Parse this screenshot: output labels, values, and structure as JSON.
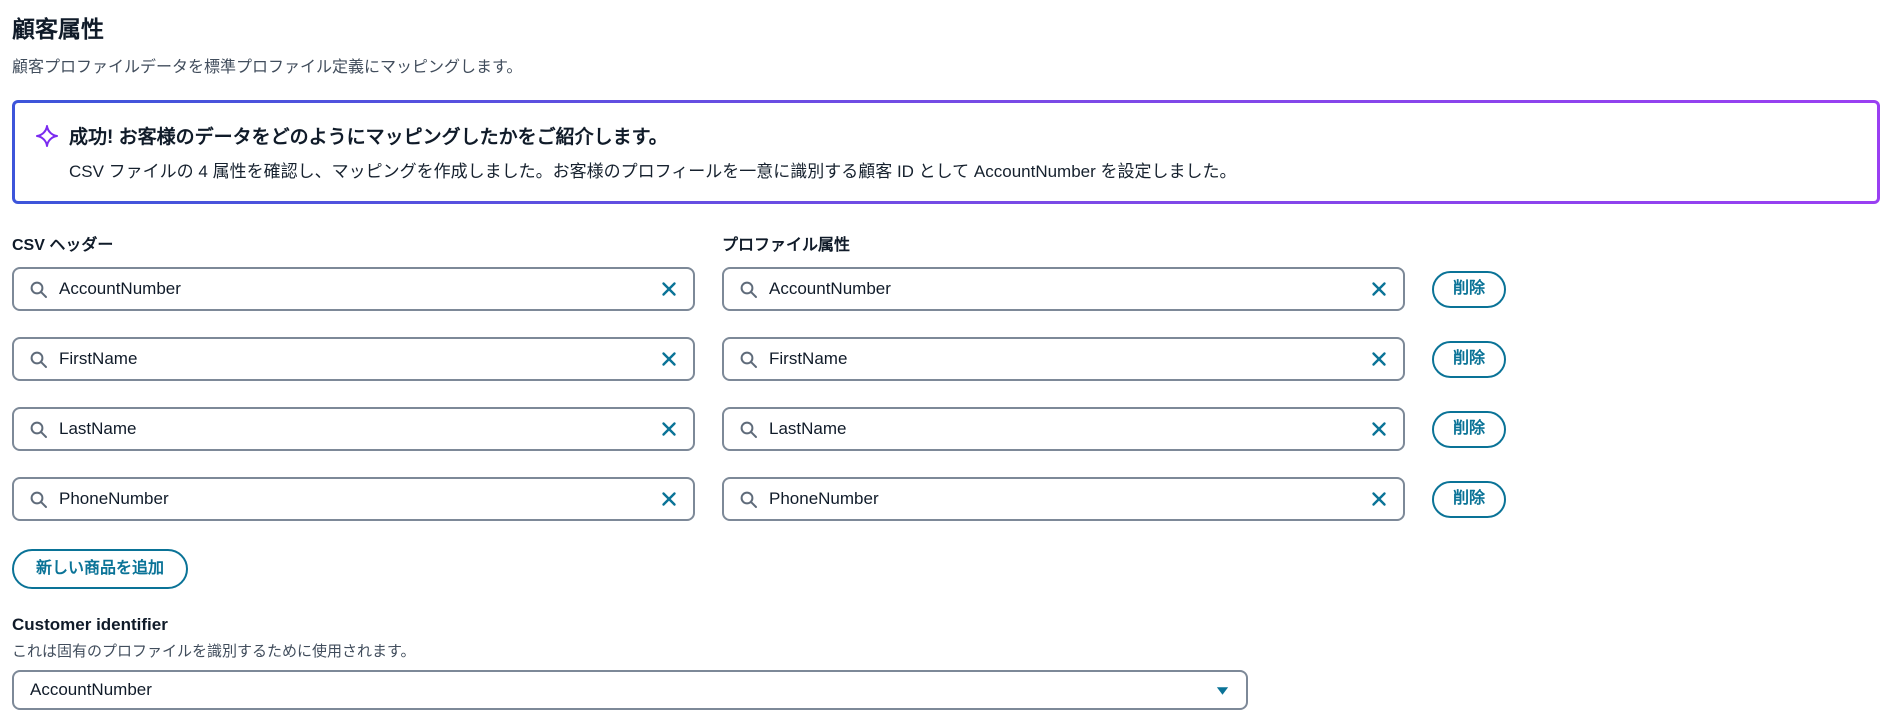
{
  "page": {
    "title": "顧客属性",
    "subtitle": "顧客プロファイルデータを標準プロファイル定義にマッピングします。"
  },
  "banner": {
    "icon": "sparkle-icon",
    "title": "成功! お客様のデータをどのようにマッピングしたかをご紹介します。",
    "description": "CSV ファイルの 4 属性を確認し、マッピングを作成しました。お客様のプロフィールを一意に識別する顧客 ID として AccountNumber を設定しました。"
  },
  "mapping": {
    "csv_header_label": "CSV ヘッダー",
    "profile_attribute_label": "プロファイル属性",
    "delete_label": "削除",
    "add_button_label": "新しい商品を追加",
    "rows": [
      {
        "csv_header": "AccountNumber",
        "profile_attribute": "AccountNumber"
      },
      {
        "csv_header": "FirstName",
        "profile_attribute": "FirstName"
      },
      {
        "csv_header": "LastName",
        "profile_attribute": "LastName"
      },
      {
        "csv_header": "PhoneNumber",
        "profile_attribute": "PhoneNumber"
      }
    ]
  },
  "customer_identifier": {
    "label": "Customer identifier",
    "description": "これは固有のプロファイルを識別するために使用されます。",
    "selected_value": "AccountNumber"
  },
  "icons": {
    "search": "search-icon",
    "clear": "clear-x-icon",
    "caret": "caret-down-icon"
  },
  "colors": {
    "accent_teal": "#0a7397",
    "banner_gradient_start": "#3d55da",
    "banner_gradient_end": "#9a3ff2",
    "sparkle_purple": "#7b2bf0",
    "input_border": "#7d8998",
    "text_primary": "#101b29",
    "text_secondary": "#414d5c"
  }
}
